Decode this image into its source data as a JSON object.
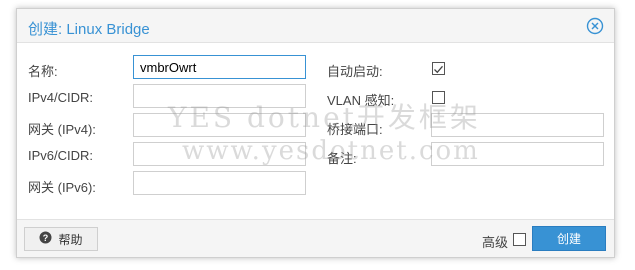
{
  "dialog": {
    "title": "创建: Linux Bridge",
    "close_icon": "close-circle-icon",
    "accent_color": "#3892d4"
  },
  "form": {
    "left": [
      {
        "label": "名称:",
        "value": "vmbrOwrt",
        "focused": true
      },
      {
        "label": "IPv4/CIDR:",
        "value": ""
      },
      {
        "label": "网关 (IPv4):",
        "value": ""
      },
      {
        "label": "IPv6/CIDR:",
        "value": ""
      },
      {
        "label": "网关 (IPv6):",
        "value": ""
      }
    ],
    "right": [
      {
        "label": "自动启动:",
        "type": "checkbox",
        "checked": true
      },
      {
        "label": "VLAN 感知:",
        "type": "checkbox",
        "checked": false
      },
      {
        "label": "桥接端口:",
        "type": "text",
        "value": ""
      },
      {
        "label": "备注:",
        "type": "text",
        "value": ""
      }
    ]
  },
  "footer": {
    "help_label": "帮助",
    "help_icon": "question-circle-icon",
    "advanced_label": "高级",
    "advanced_checked": false,
    "create_label": "创建"
  },
  "watermark": {
    "line1": "YES dotnet开发框架",
    "line2": "www.yesdotnet.com"
  }
}
